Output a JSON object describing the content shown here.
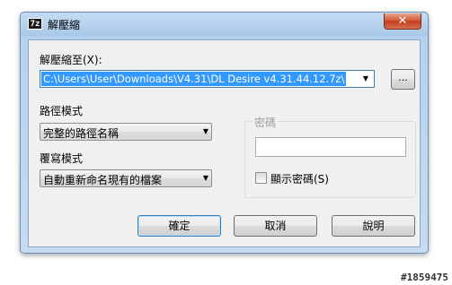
{
  "window": {
    "title": "解壓縮",
    "icon_label": "7z",
    "close_glyph": "✕"
  },
  "extract": {
    "label": "解壓縮至(X):",
    "path_value": "C:\\Users\\User\\Downloads\\V4.31\\DL Desire v4.31.44.12.7z\\",
    "browse_label": "..."
  },
  "path_mode": {
    "label": "路徑模式",
    "value": "完整的路徑名稱"
  },
  "overwrite_mode": {
    "label": "覆寫模式",
    "value": "自動重新命名現有的檔案"
  },
  "password": {
    "group_title": "密碼",
    "value": "",
    "show_label": "顯示密碼(S)",
    "show_checked": false
  },
  "buttons": {
    "ok": "確定",
    "cancel": "取消",
    "help": "說明"
  },
  "watermark": "#1859475",
  "icons": {
    "dropdown": "triangle-down",
    "close": "x-mark"
  }
}
